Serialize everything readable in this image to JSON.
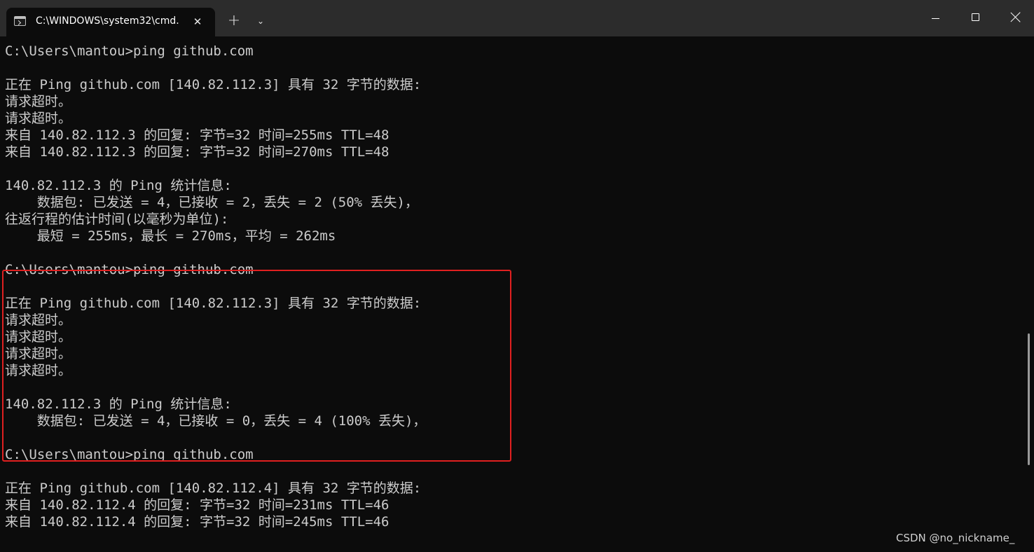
{
  "tab": {
    "title": "C:\\WINDOWS\\system32\\cmd.",
    "icon": "terminal-icon",
    "close_glyph": "✕"
  },
  "toolbar": {
    "new_tab_glyph": "+",
    "dropdown_glyph": "⌄"
  },
  "window_controls": {
    "minimize": "minimize-icon",
    "maximize": "maximize-icon",
    "close": "close-icon"
  },
  "console_lines": [
    "C:\\Users\\mantou>ping github.com",
    "",
    "正在 Ping github.com [140.82.112.3] 具有 32 字节的数据:",
    "请求超时。",
    "请求超时。",
    "来自 140.82.112.3 的回复: 字节=32 时间=255ms TTL=48",
    "来自 140.82.112.3 的回复: 字节=32 时间=270ms TTL=48",
    "",
    "140.82.112.3 的 Ping 统计信息:",
    "    数据包: 已发送 = 4，已接收 = 2，丢失 = 2 (50% 丢失)，",
    "往返行程的估计时间(以毫秒为单位):",
    "    最短 = 255ms，最长 = 270ms，平均 = 262ms",
    "",
    "C:\\Users\\mantou>ping github.com",
    "",
    "正在 Ping github.com [140.82.112.3] 具有 32 字节的数据:",
    "请求超时。",
    "请求超时。",
    "请求超时。",
    "请求超时。",
    "",
    "140.82.112.3 的 Ping 统计信息:",
    "    数据包: 已发送 = 4，已接收 = 0，丢失 = 4 (100% 丢失)，",
    "",
    "C:\\Users\\mantou>ping github.com",
    "",
    "正在 Ping github.com [140.82.112.4] 具有 32 字节的数据:",
    "来自 140.82.112.4 的回复: 字节=32 时间=231ms TTL=46",
    "来自 140.82.112.4 的回复: 字节=32 时间=245ms TTL=46"
  ],
  "watermark": "CSDN @no_nickname_",
  "colors": {
    "background": "#0c0c0c",
    "titlebar": "#2c2c2c",
    "text": "#cccccc",
    "highlight_border": "#e02020"
  }
}
